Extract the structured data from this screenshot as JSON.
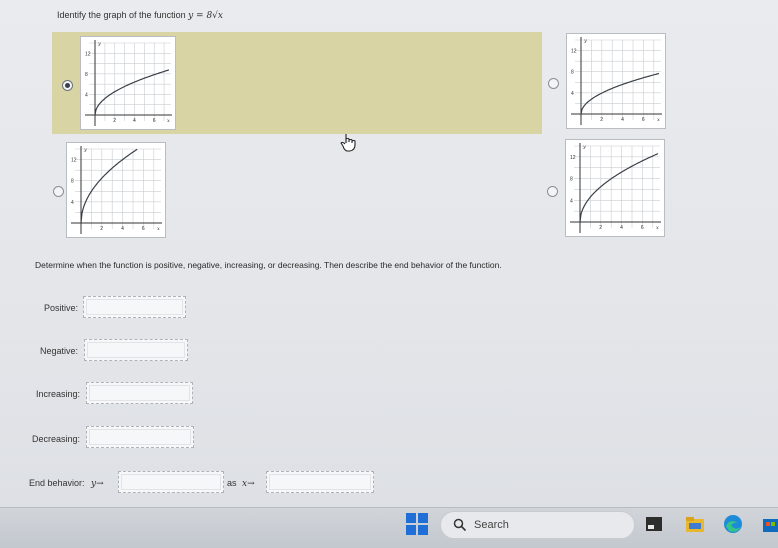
{
  "question": {
    "prefix": "Identify the graph of the function",
    "function": "y = 8√x"
  },
  "options": [
    {
      "id": "A",
      "selected": true,
      "shape": "sqrt",
      "ticks_y": [
        "12",
        "8",
        "4"
      ],
      "ticks_x": [
        "2",
        "4",
        "6"
      ],
      "axis_x": "x",
      "axis_y": "y"
    },
    {
      "id": "B",
      "selected": false,
      "shape": "sqrt-shifted",
      "ticks_y": [
        "12",
        "8",
        "4"
      ],
      "ticks_x": [
        "2",
        "4",
        "6"
      ],
      "axis_x": "x",
      "axis_y": "y"
    },
    {
      "id": "C",
      "selected": false,
      "shape": "steep",
      "ticks_y": [
        "12",
        "8",
        "4"
      ],
      "ticks_x": [
        "2",
        "4",
        "6"
      ],
      "axis_x": "x",
      "axis_y": "y"
    },
    {
      "id": "D",
      "selected": false,
      "shape": "sqrt-tall",
      "ticks_y": [
        "12",
        "8",
        "4"
      ],
      "ticks_x": [
        "2",
        "4",
        "6"
      ],
      "axis_x": "x",
      "axis_y": "y"
    }
  ],
  "instructions": "Determine when the function is positive, negative, increasing, or decreasing. Then describe the end behavior of the function.",
  "fields": {
    "positive_label": "Positive:",
    "negative_label": "Negative:",
    "increasing_label": "Increasing:",
    "decreasing_label": "Decreasing:",
    "positive_value": "",
    "negative_value": "",
    "increasing_value": "",
    "decreasing_value": ""
  },
  "end_behavior": {
    "label": "End behavior:",
    "y_arrow": "y→",
    "as_text": "as",
    "x_arrow": "x→",
    "y_value": "",
    "x_value": ""
  },
  "taskbar": {
    "search_label": "Search"
  },
  "colors": {
    "selected_row": "#d8d4a4",
    "curve": "#3a4048",
    "windows_blue": "#1f6fd6"
  }
}
